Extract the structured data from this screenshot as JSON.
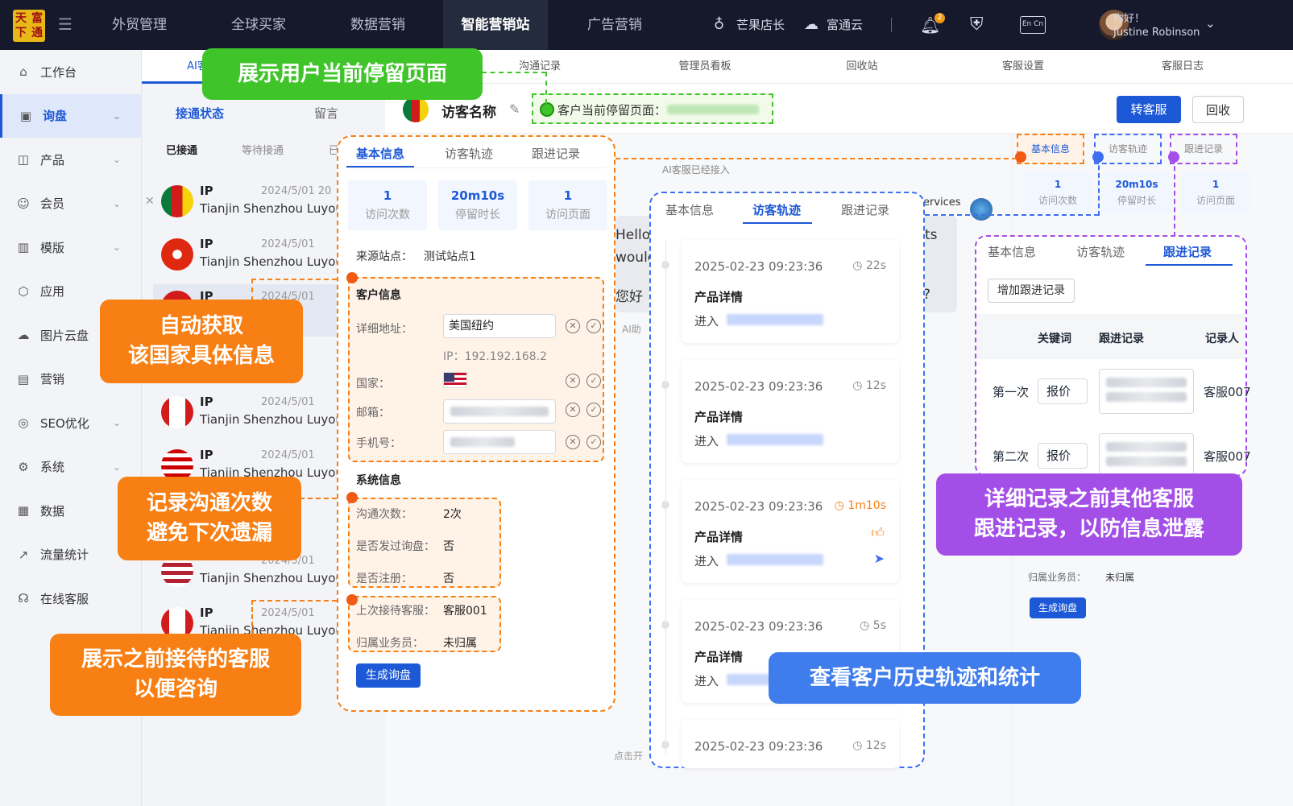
{
  "logo": {
    "chars": [
      "天",
      "富",
      "下",
      "通"
    ]
  },
  "topnav": [
    "外贸管理",
    "全球买家",
    "数据营销",
    "智能营销站",
    "广告营销"
  ],
  "topright": {
    "shop": "芒果店长",
    "cloud": "富通云",
    "badge": "2",
    "lang": "En Cn",
    "greet": "你好！",
    "user": "Justine Robinson"
  },
  "sidebar": [
    {
      "label": "工作台",
      "icon": "home-icon",
      "glyph": "⌂",
      "chev": false
    },
    {
      "label": "询盘",
      "icon": "inquiry-icon",
      "glyph": "▣",
      "chev": true,
      "active": true
    },
    {
      "label": "产品",
      "icon": "product-icon",
      "glyph": "◫",
      "chev": true
    },
    {
      "label": "会员",
      "icon": "member-icon",
      "glyph": "☺",
      "chev": true
    },
    {
      "label": "模版",
      "icon": "template-icon",
      "glyph": "▥",
      "chev": true
    },
    {
      "label": "应用",
      "icon": "app-icon",
      "glyph": "⬡",
      "chev": false
    },
    {
      "label": "图片云盘",
      "icon": "cloud-icon",
      "glyph": "☁",
      "chev": false
    },
    {
      "label": "营销",
      "icon": "marketing-icon",
      "glyph": "▤",
      "chev": false
    },
    {
      "label": "SEO优化",
      "icon": "seo-icon",
      "glyph": "◎",
      "chev": true
    },
    {
      "label": "系统",
      "icon": "system-icon",
      "glyph": "⚙",
      "chev": true
    },
    {
      "label": "数据",
      "icon": "data-icon",
      "glyph": "▦",
      "chev": false
    },
    {
      "label": "流量统计",
      "icon": "traffic-icon",
      "glyph": "↗",
      "chev": false
    },
    {
      "label": "在线客服",
      "icon": "service-icon",
      "glyph": "☊",
      "chev": false
    }
  ],
  "tabs": [
    "AI客服",
    "沟通记录",
    "管理员看板",
    "回收站",
    "客服设置",
    "客服日志"
  ],
  "subtabs": {
    "a": "接通状态",
    "b": "留言",
    "c": "已接通",
    "d": "等待接通",
    "e": "已"
  },
  "visitor": {
    "name": "访客名称",
    "current_page_label": "客户当前停留页面：",
    "transfer": "转客服",
    "recycle": "回收",
    "ai_joined": "AI客服已经接入"
  },
  "list": [
    {
      "title": "IP",
      "date": "2024/5/01  20",
      "sub": "Tianjin Shenzhou Luyou"
    },
    {
      "title": "IP",
      "date": "2024/5/01",
      "sub": "Tianjin Shenzhou Luyou"
    },
    {
      "title": "IP",
      "date": "2024/5/01",
      "sub": "Luyou"
    },
    {
      "title": "",
      "date": "/5/01",
      "sub": "Luyou"
    },
    {
      "title": "IP",
      "date": "2024/5/01",
      "sub": "Tianjin Shenzhou Luyou"
    },
    {
      "title": "IP",
      "date": "2024/5/01",
      "sub": "Tianjin Shenzhou Luyou"
    },
    {
      "title": "",
      "date": "/5/01",
      "sub": "Luyou"
    },
    {
      "title": "",
      "date": "2024/5/01",
      "sub": "Tianjin Shenzhou Luyou"
    },
    {
      "title": "IP",
      "date": "2024/5/01",
      "sub": "Tianjin Shenzhou Luyou"
    },
    {
      "title": "",
      "date": "/5/01",
      "sub": "Luyou"
    }
  ],
  "info": {
    "tabs": [
      "基本信息",
      "访客轨迹",
      "跟进记录"
    ],
    "stats": [
      {
        "v": "1",
        "l": "访问次数"
      },
      {
        "v": "20m10s",
        "l": "停留时长"
      },
      {
        "v": "1",
        "l": "访问页面"
      }
    ],
    "source_label": "来源站点：",
    "source": "测试站点1",
    "customer_title": "客户信息",
    "addr_label": "详细地址：",
    "addr": "美国纽约",
    "ip": "IP：192.192.168.2",
    "country_label": "国家：",
    "email_label": "邮箱：",
    "phone_label": "手机号：",
    "system_title": "系统信息",
    "comm_label": "沟通次数：",
    "comm": "2次",
    "inq_label": "是否发过询盘：",
    "inq": "否",
    "reg_label": "是否注册：",
    "reg": "否",
    "last_label": "上次接待客服：",
    "last": "客服001",
    "owner_label": "归属业务员：",
    "owner": "未归属",
    "gen": "生成询盘"
  },
  "track": {
    "tabs": [
      "基本信息",
      "访客轨迹",
      "跟进记录"
    ],
    "items": [
      {
        "time": "2025-02-23 09:23:36",
        "dur": "22s",
        "p": "产品详情",
        "e": "进入"
      },
      {
        "time": "2025-02-23 09:23:36",
        "dur": "12s",
        "p": "产品详情",
        "e": "进入"
      },
      {
        "time": "2025-02-23 09:23:36",
        "dur": "1m10s",
        "p": "产品详情",
        "e": "进入"
      },
      {
        "time": "2025-02-23 09:23:36",
        "dur": "5s",
        "p": "产品详情",
        "e": "进入"
      },
      {
        "time": "2025-02-23 09:23:36",
        "dur": "12s",
        "p": "",
        "e": ""
      }
    ]
  },
  "follow": {
    "tabs": [
      "基本信息",
      "访客轨迹",
      "跟进记录"
    ],
    "add": "增加跟进记录",
    "headers": [
      "关键词",
      "跟进记录",
      "记录人"
    ],
    "rows": [
      {
        "n": "第一次",
        "k": "报价",
        "r": "客服007"
      },
      {
        "n": "第二次",
        "k": "报价",
        "r": "客服007"
      }
    ]
  },
  "mini": {
    "tabs": [
      "基本信息",
      "访客轨迹",
      "跟进记录"
    ],
    "stats": [
      {
        "v": "1",
        "l": "访问次数"
      },
      {
        "v": "20m10s",
        "l": "停留时长"
      },
      {
        "v": "1",
        "l": "访问页面"
      }
    ],
    "owner_label": "归属业务员：",
    "owner": "未归属",
    "gen": "生成询盘"
  },
  "chat": {
    "a": "Hello",
    "b": "would",
    "c": "您好",
    "d": "AI助",
    "e": "ervices",
    "f": "ts",
    "g": "?",
    "start": "点击开"
  },
  "callouts": {
    "c1": "展示用户当前停留页面",
    "c2a": "自动获取",
    "c2b": "该国家具体信息",
    "c3a": "记录沟通次数",
    "c3b": "避免下次遗漏",
    "c4a": "展示之前接待的客服",
    "c4b": "以便咨询",
    "c5a": "详细记录之前其他客服",
    "c5b": "跟进记录，以防信息泄露",
    "c6": "查看客户历史轨迹和统计"
  }
}
